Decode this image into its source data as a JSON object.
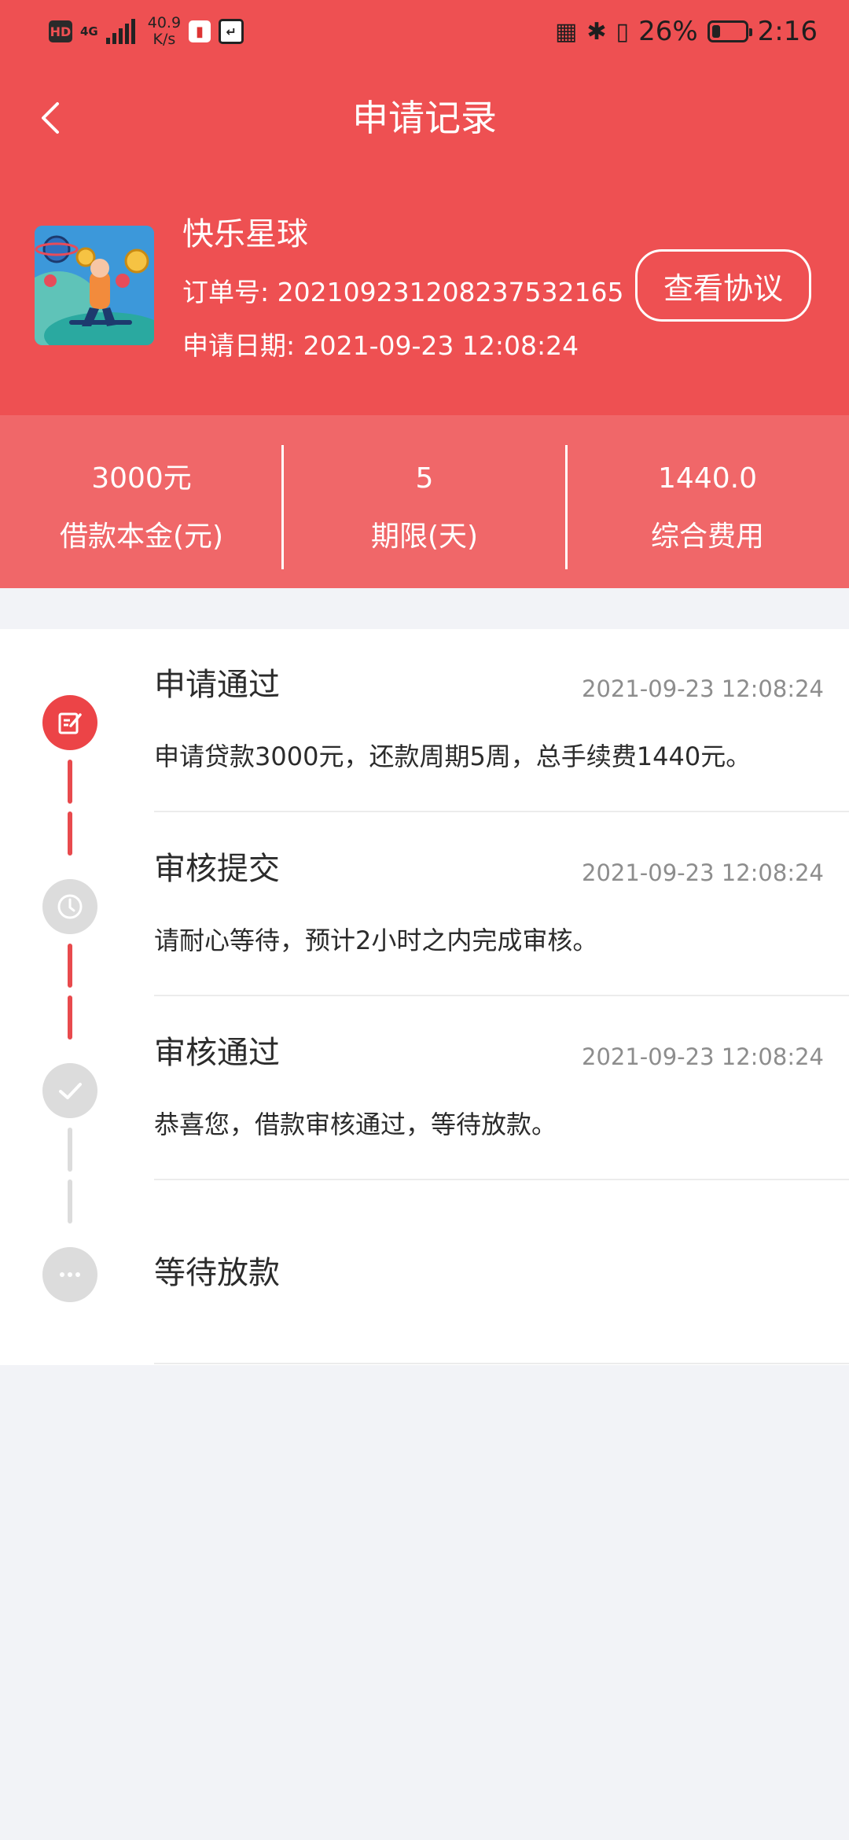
{
  "status_bar": {
    "hd": "HD",
    "network": "4G",
    "speed_value": "40.9",
    "speed_unit": "K/s",
    "battery_percent": "26%",
    "battery_level": 0.26,
    "time": "2:16",
    "icons": [
      "book-app-icon",
      "app-b-icon",
      "nfc-icon",
      "bluetooth-icon",
      "vibrate-icon",
      "battery-icon"
    ]
  },
  "header": {
    "title": "申请记录",
    "back_icon": "chevron-left-icon"
  },
  "order": {
    "app_name": "快乐星球",
    "order_no": "订单号: 20210923120823753216​5",
    "apply_date": "申请日期: 2021-09-23 12:08:24",
    "view_agreement": "查看协议"
  },
  "stats": [
    {
      "value": "3000元",
      "label": "借款本金(元)"
    },
    {
      "value": "5",
      "label": "期限(天)"
    },
    {
      "value": "1440.0",
      "label": "综合费用"
    }
  ],
  "timeline": [
    {
      "title": "申请通过",
      "time": "2021-09-23 12:08:24",
      "desc": "申请贷款3000元，还款周期5周，总手续费1440元。",
      "icon": "edit-note-icon",
      "state": "active"
    },
    {
      "title": "审核提交",
      "time": "2021-09-23 12:08:24",
      "desc": "请耐心等待，预计2小时之内完成审核。",
      "icon": "clock-icon",
      "state": "inactive"
    },
    {
      "title": "审核通过",
      "time": "2021-09-23 12:08:24",
      "desc": "恭喜您，借款审核通过，等待放款。",
      "icon": "checkmark-icon",
      "state": "inactive"
    },
    {
      "title": "等待放款",
      "time": "",
      "desc": "",
      "icon": "more-dots-icon",
      "state": "inactive"
    }
  ],
  "colors": {
    "brand_red": "#ee5052",
    "stats_bg": "#f06769",
    "timeline_active": "#ec4447",
    "timeline_inactive": "#dcdcdc"
  }
}
